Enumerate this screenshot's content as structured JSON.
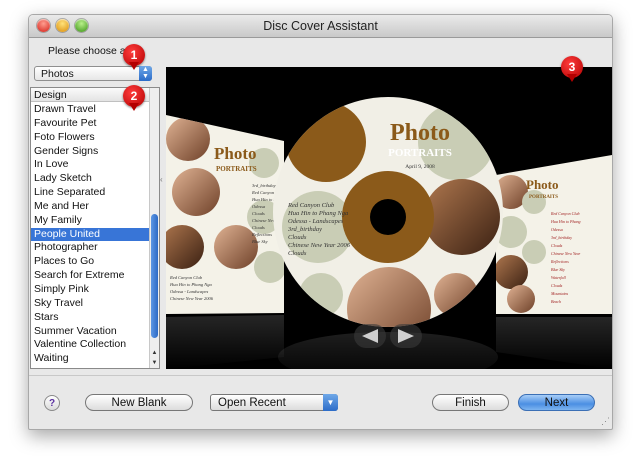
{
  "window": {
    "title": "Disc Cover Assistant"
  },
  "prompt": "Please choose a de",
  "theme_select": {
    "value": "Photos"
  },
  "design_list": {
    "header": "Design",
    "items": [
      "Drawn Travel",
      "Favourite Pet",
      "Foto Flowers",
      "Gender Signs",
      "In Love",
      "Lady Sketch",
      "Line Separated",
      "Me and Her",
      "My Family",
      "People United",
      "Photographer",
      "Places to Go",
      "Search for Extreme",
      "Simply Pink",
      "Sky Travel",
      "Stars",
      "Summer Vacation",
      "Valentine Collection",
      "Waiting"
    ],
    "selected": "People United"
  },
  "preview": {
    "title_big": "Photo",
    "title_small": "PORTRAITS",
    "date": "April 9, 2008",
    "disc_tracklist": [
      "Red Canyon Club",
      "Hua Hin to Phang Nga",
      "Odessa - Landscapes",
      "3rd_birthday",
      "Clouds",
      "Chinese New Year 2006",
      "Clouds"
    ],
    "left_cover_title_big": "Photo",
    "left_cover_title_small": "PORTRAITS",
    "left_cover_list": [
      "3rd_birthday",
      "Red Canyon Club",
      "Hua Hin to Phang",
      "Odessa",
      "Clouds",
      "Chinese New Year",
      "Clouds",
      "Reflections",
      "Blue Sky"
    ],
    "left_cover_footer": [
      "Red Canyon Club",
      "Hua Hin to Phang Nga",
      "Odessa - Landscapes",
      "Chinese New Year 2006"
    ],
    "right_cover_title_big": "Photo",
    "right_cover_title_small": "PORTRAITS",
    "right_cover_list": [
      "Red Canyon Club",
      "Hua Hin to Phang",
      "Odessa",
      "3rd_birthday",
      "Clouds",
      "Chinese New Year",
      "Reflections",
      "Blue Sky",
      "Waterfall",
      "Clouds",
      "Mountains",
      "Beach"
    ]
  },
  "buttons": {
    "help": "?",
    "new_blank": "New Blank",
    "open_recent": "Open Recent",
    "finish": "Finish",
    "next": "Next"
  },
  "callouts": [
    "1",
    "2",
    "3"
  ],
  "colors": {
    "accent": "#3875d7",
    "disc_brown": "#8b5a1a",
    "disc_sage": "#c9cdb5",
    "callout_red": "#cc0000"
  }
}
